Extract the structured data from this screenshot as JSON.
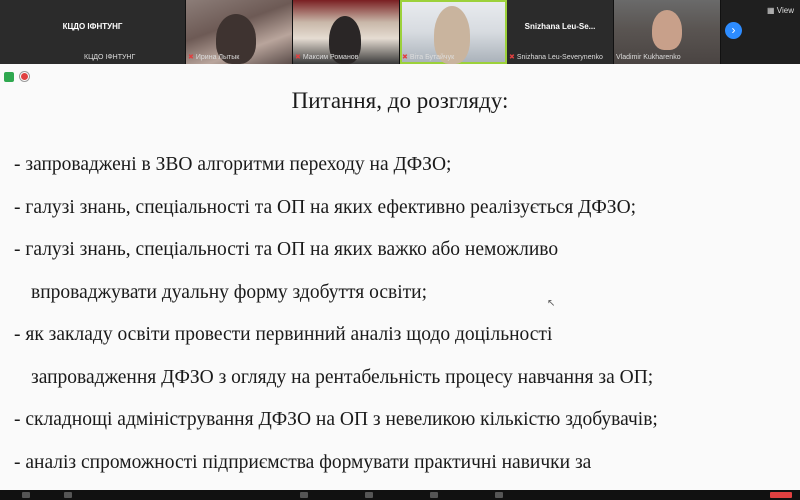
{
  "participants": [
    {
      "center_name": "КЦДО ІФНТУНГ",
      "caption": "КЦДО ІФНТУНГ",
      "muted": false
    },
    {
      "caption": "Ирина Лытык",
      "muted": true
    },
    {
      "caption": "Максим Романов",
      "muted": true
    },
    {
      "caption": "Віта Бутайчук",
      "muted": true
    },
    {
      "center_name": "Snizhana Leu-Se...",
      "caption": "Snizhana Leu-Severynenko",
      "muted": true
    },
    {
      "caption": "Vladimir Kukharenko",
      "muted": false
    }
  ],
  "toolbar": {
    "view_label": "View"
  },
  "icons": {
    "next": "chevron-right-icon",
    "security": "shield-icon",
    "record": "record-icon",
    "mic_muted": "mic-off-icon"
  },
  "colors": {
    "active_speaker": "#9cd13a",
    "accent": "#2d8cff",
    "muted_mic": "#e04040"
  },
  "slide": {
    "title": "Питання, до розгляду:",
    "lines": [
      "- запроваджені в ЗВО алгоритми переходу на ДФЗО;",
      "- галузі знань, спеціальності та ОП на яких ефективно реалізується ДФЗО;",
      "- галузі знань, спеціальності та ОП на яких важко або неможливо",
      "впроваджувати дуальну форму здобуття освіти;",
      "- як закладу освіти провести первинний аналіз щодо доцільності",
      "запровадження ДФЗО з огляду на рентабельність процесу навчання за ОП;",
      "- складнощі адміністрування ДФЗО на ОП з невеликою кількістю здобувачів;",
      "- аналіз спроможності підприємства формувати практичні навички за"
    ]
  }
}
